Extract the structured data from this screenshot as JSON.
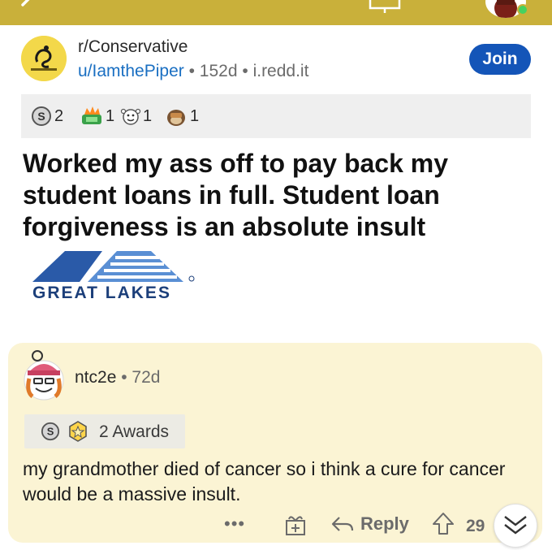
{
  "topbar": {
    "color": "#c9b03a"
  },
  "post": {
    "subreddit": "r/Conservative",
    "username": "u/IamthePiper",
    "separator": "•",
    "age": "152d",
    "domain": "i.redd.it",
    "join_label": "Join",
    "awards": [
      {
        "icon": "silver-award-icon",
        "count": "2"
      },
      {
        "icon": "money-award-icon",
        "count": "1"
      },
      {
        "icon": "wholesome-award-icon",
        "count": "1"
      },
      {
        "icon": "facepalm-award-icon",
        "count": "1"
      }
    ],
    "title": "Worked my ass off to pay back my student loans in full. Student loan forgiveness is an absolute insult",
    "image_logo_text": "GREAT LAKES"
  },
  "comment": {
    "username": "ntc2e",
    "separator": "•",
    "age": "72d",
    "awards_label": "2 Awards",
    "body": "my grandmother died of cancer so i think a cure for cancer would be a massive insult.",
    "more_label": "•••",
    "reply_label": "Reply",
    "votes": "29",
    "card_color": "#fbf4d4"
  }
}
